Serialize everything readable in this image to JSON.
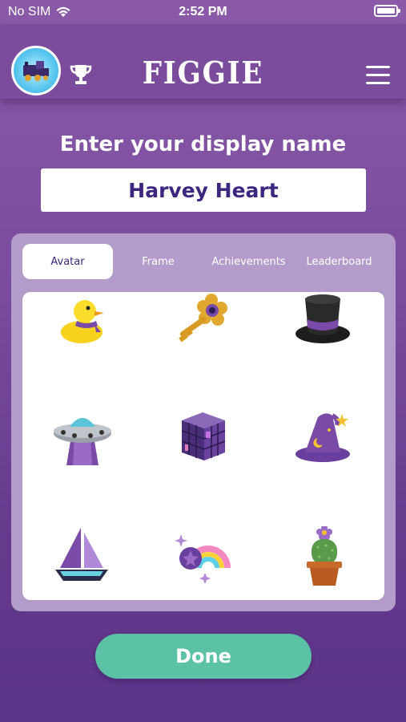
{
  "status_bar": {
    "carrier": "No SIM",
    "time": "2:52 PM"
  },
  "header": {
    "logo_text": "FIGGIE"
  },
  "name_prompt": "Enter your display name",
  "display_name_value": "Harvey Heart",
  "tabs": [
    {
      "label": "Avatar",
      "active": true
    },
    {
      "label": "Frame",
      "active": false
    },
    {
      "label": "Achievements",
      "active": false
    },
    {
      "label": "Leaderboard",
      "active": false
    }
  ],
  "avatars": [
    {
      "icon": "rubber-duck-icon"
    },
    {
      "icon": "golden-key-icon"
    },
    {
      "icon": "top-hat-icon"
    },
    {
      "icon": "ufo-icon"
    },
    {
      "icon": "cube-icon"
    },
    {
      "icon": "wizard-hat-icon"
    },
    {
      "icon": "sailboat-icon"
    },
    {
      "icon": "rainbow-icon"
    },
    {
      "icon": "cactus-icon"
    }
  ],
  "done_label": "Done",
  "colors": {
    "background": "#7a4b9e",
    "accent_button": "#5cc2a6",
    "panel": "#b39cc9",
    "name_text": "#3d2680"
  }
}
